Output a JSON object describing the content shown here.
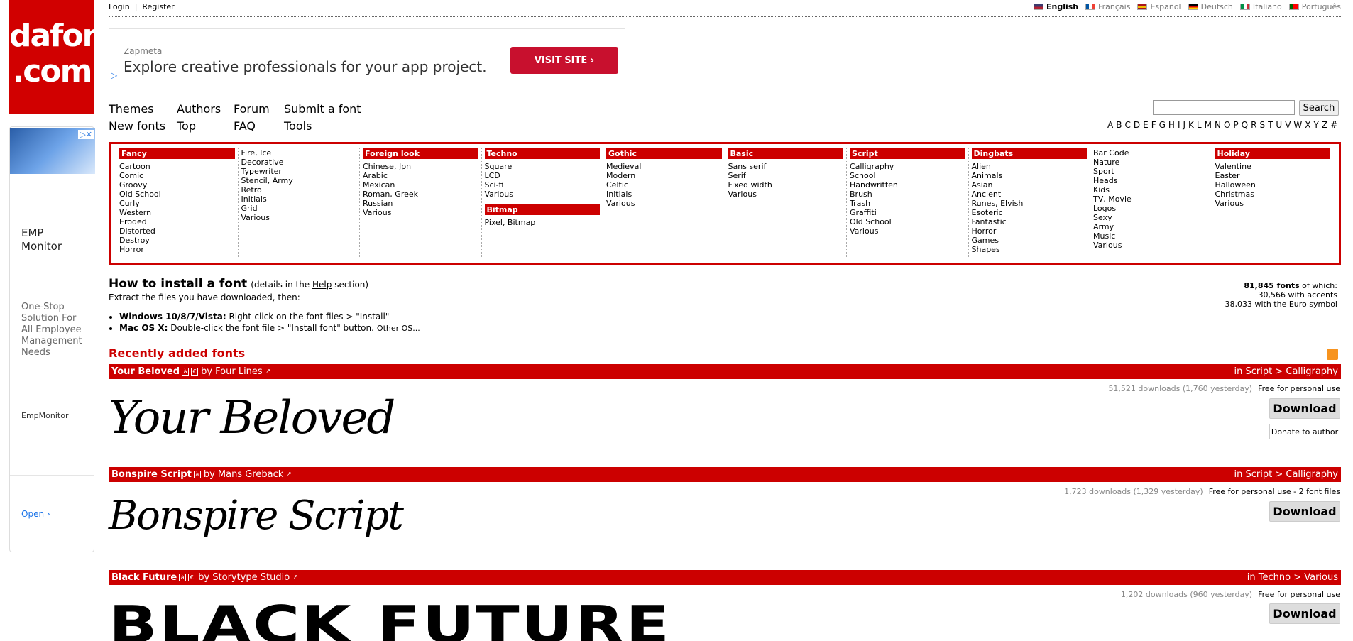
{
  "logo": {
    "text_top": "dafont",
    "text_bottom": ".com"
  },
  "left_ad": {
    "title": "EMP Monitor",
    "tagline": "One-Stop Solution For All Employee Management Needs",
    "brand": "EmpMonitor",
    "open": "Open"
  },
  "topbar": {
    "login": "Login",
    "sep": "|",
    "register": "Register",
    "languages": [
      {
        "label": "English",
        "active": true,
        "color": "#3c3b6e"
      },
      {
        "label": "Français",
        "active": false,
        "color": "#0055a4"
      },
      {
        "label": "Español",
        "active": false,
        "color": "#f1bf00"
      },
      {
        "label": "Deutsch",
        "active": false,
        "color": "#000000"
      },
      {
        "label": "Italiano",
        "active": false,
        "color": "#009246"
      },
      {
        "label": "Português",
        "active": false,
        "color": "#006600"
      }
    ]
  },
  "top_ad": {
    "brand": "Zapmeta",
    "headline": "Explore creative professionals for your app project.",
    "cta": "VISIT SITE ›"
  },
  "nav": {
    "themes": "Themes",
    "authors": "Authors",
    "forum": "Forum",
    "submit": "Submit a font",
    "new_fonts": "New fonts",
    "top": "Top",
    "faq": "FAQ",
    "tools": "Tools",
    "search_label": "Search"
  },
  "alphabet": [
    "A",
    "B",
    "C",
    "D",
    "E",
    "F",
    "G",
    "H",
    "I",
    "J",
    "K",
    "L",
    "M",
    "N",
    "O",
    "P",
    "Q",
    "R",
    "S",
    "T",
    "U",
    "V",
    "W",
    "X",
    "Y",
    "Z",
    "#"
  ],
  "categories": {
    "fancy": {
      "title": "Fancy",
      "items": [
        "Cartoon",
        "Comic",
        "Groovy",
        "Old School",
        "Curly",
        "Western",
        "Eroded",
        "Distorted",
        "Destroy",
        "Horror"
      ]
    },
    "fancy2": {
      "items": [
        "Fire, Ice",
        "Decorative",
        "Typewriter",
        "Stencil, Army",
        "Retro",
        "Initials",
        "Grid",
        "Various"
      ]
    },
    "foreign": {
      "title": "Foreign look",
      "items": [
        "Chinese, Jpn",
        "Arabic",
        "Mexican",
        "Roman, Greek",
        "Russian",
        "Various"
      ]
    },
    "techno": {
      "title": "Techno",
      "items": [
        "Square",
        "LCD",
        "Sci-fi",
        "Various"
      ]
    },
    "bitmap": {
      "title": "Bitmap",
      "items": [
        "Pixel, Bitmap"
      ]
    },
    "gothic": {
      "title": "Gothic",
      "items": [
        "Medieval",
        "Modern",
        "Celtic",
        "Initials",
        "Various"
      ]
    },
    "basic": {
      "title": "Basic",
      "items": [
        "Sans serif",
        "Serif",
        "Fixed width",
        "Various"
      ]
    },
    "script": {
      "title": "Script",
      "items": [
        "Calligraphy",
        "School",
        "Handwritten",
        "Brush",
        "Trash",
        "Graffiti",
        "Old School",
        "Various"
      ]
    },
    "dingbats": {
      "title": "Dingbats",
      "items": [
        "Alien",
        "Animals",
        "Asian",
        "Ancient",
        "Runes, Elvish",
        "Esoteric",
        "Fantastic",
        "Horror",
        "Games",
        "Shapes"
      ]
    },
    "dingbats2": {
      "items": [
        "Bar Code",
        "Nature",
        "Sport",
        "Heads",
        "Kids",
        "TV, Movie",
        "Logos",
        "Sexy",
        "Army",
        "Music",
        "Various"
      ]
    },
    "holiday": {
      "title": "Holiday",
      "items": [
        "Valentine",
        "Easter",
        "Halloween",
        "Christmas",
        "Various"
      ]
    }
  },
  "install": {
    "title": "How to install a font",
    "details_pre": "(details in the ",
    "help": "Help",
    "details_post": " section)",
    "extract": "Extract the files you have downloaded, then:",
    "win_label": "Windows 10/8/7/Vista:",
    "win_text": " Right-click on the font files > \"Install\"",
    "mac_label": "Mac OS X:",
    "mac_text": " Double-click the font file > \"Install font\" button.",
    "other_os": "Other OS..."
  },
  "stats": {
    "total": "81,845 fonts",
    "of_which": " of which:",
    "accents": "30,566 with accents",
    "euro": "38,033 with the Euro symbol"
  },
  "recent": {
    "title": "Recently added fonts"
  },
  "fonts": [
    {
      "name": "Your Beloved",
      "by": "by Four Lines",
      "category": "in Script > Calligraphy",
      "downloads": "51,521 downloads (1,760 yesterday)",
      "license": "Free for personal use",
      "download": "Download",
      "donate": "Donate to author",
      "preview": "Your Beloved"
    },
    {
      "name": "Bonspire Script",
      "by": "by Mans Greback",
      "category": "in Script > Calligraphy",
      "downloads": "1,723 downloads (1,329 yesterday)",
      "license": "Free for personal use - 2 font files",
      "download": "Download",
      "preview": "Bonspire Script"
    },
    {
      "name": "Black Future",
      "by": "by Storytype Studio",
      "category": "in Techno > Various",
      "downloads": "1,202 downloads (960 yesterday)",
      "license": "Free for personal use",
      "download": "Download",
      "preview": "BLACK FUTURE"
    }
  ],
  "colors": {
    "brand": "#cc0000"
  }
}
